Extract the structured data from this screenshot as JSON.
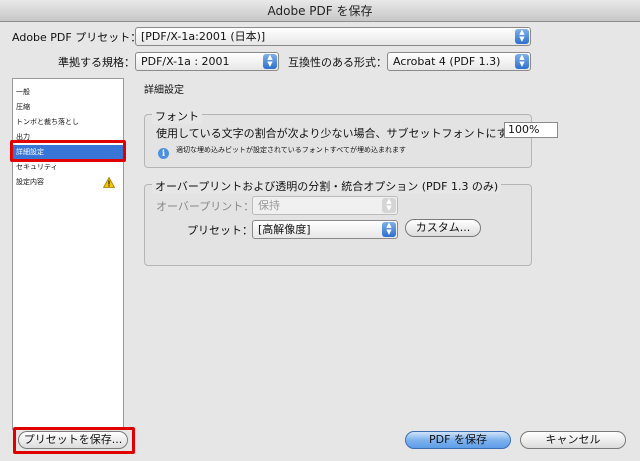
{
  "window": {
    "title": "Adobe PDF を保存"
  },
  "header": {
    "preset_label": "Adobe PDF プリセット：",
    "preset_value": "[PDF/X-1a:2001 (日本)]",
    "standard_label": "準拠する規格：",
    "standard_value": "PDF/X-1a : 2001",
    "compat_label": "互換性のある形式：",
    "compat_value": "Acrobat 4 (PDF 1.3)"
  },
  "sidebar": {
    "items": [
      {
        "label": "一般"
      },
      {
        "label": "圧縮"
      },
      {
        "label": "トンボと裁ち落とし"
      },
      {
        "label": "出力"
      },
      {
        "label": "詳細設定"
      },
      {
        "label": "セキュリティ"
      },
      {
        "label": "設定内容"
      }
    ]
  },
  "main": {
    "section_title": "詳細設定",
    "font_group": {
      "title": "フォント",
      "subset_label": "使用している文字の割合が次より少ない場合、サブセットフォントにする：",
      "subset_value": "100%",
      "note": "適切な埋め込みビットが設定されているフォントすべてが埋め込まれます"
    },
    "overprint_group": {
      "title": "オーバープリントおよび透明の分割・統合オプション (PDF 1.3 のみ)",
      "overprint_label": "オーバープリント：",
      "overprint_value": "保持",
      "preset_label": "プリセット：",
      "preset_value": "[高解像度]",
      "custom_button": "カスタム..."
    }
  },
  "footer": {
    "save_preset_button": "プリセットを保存...",
    "save_pdf_button": "PDF を保存",
    "cancel_button": "キャンセル"
  },
  "colors": {
    "selection": "#3875d7",
    "highlight": "#e00000",
    "accent": "#5f9de8"
  }
}
